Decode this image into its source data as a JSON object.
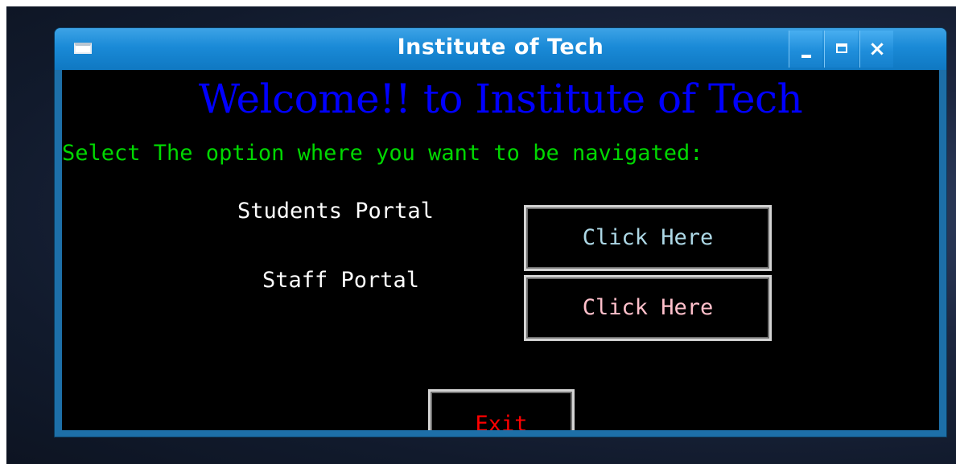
{
  "window": {
    "title": "Institute of Tech",
    "controls": {
      "minimize": "minimize-icon",
      "maximize": "maximize-icon",
      "close": "close-icon"
    }
  },
  "main": {
    "welcome_text": "Welcome!! to Institute of Tech",
    "select_text": "Select The option where you want to be navigated:",
    "students_label": "Students Portal",
    "students_button": "Click Here",
    "staff_label": "Staff Portal",
    "staff_button": "Click Here",
    "exit_button": "Exit"
  },
  "colors": {
    "welcome": "#0000ff",
    "select_text": "#00d800",
    "students_button_text": "#add8e6",
    "staff_button_text": "#ffc0cb",
    "exit_button_text": "#ff0000",
    "background": "#000000",
    "titlebar": "#1a8ad7"
  }
}
